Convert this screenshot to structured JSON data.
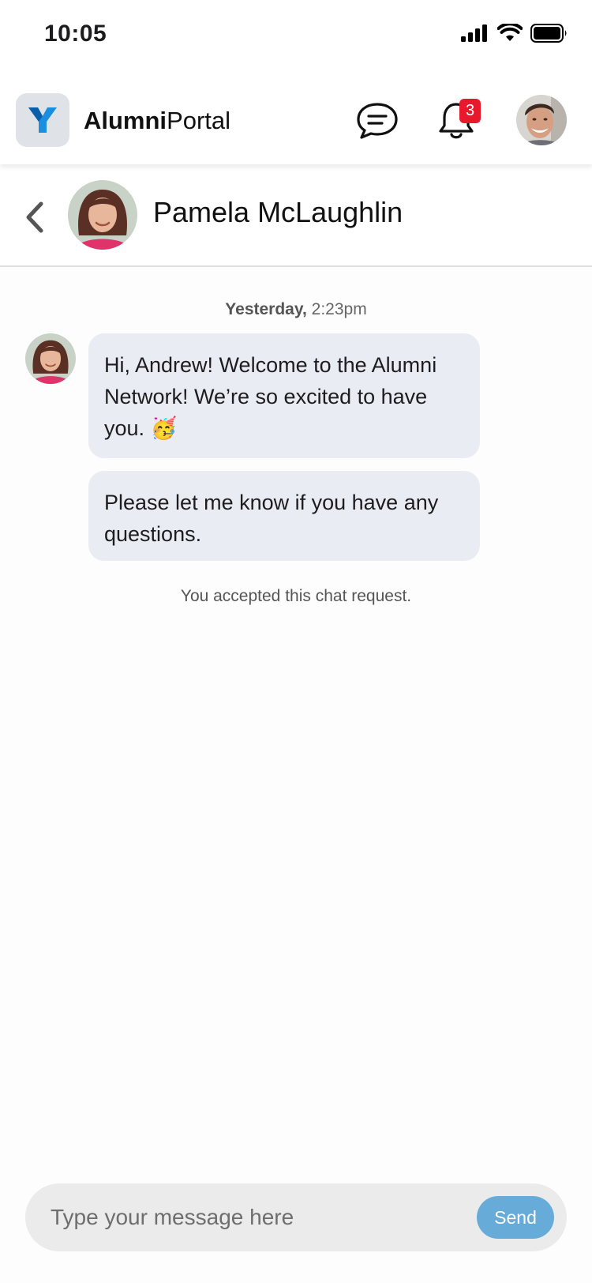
{
  "status_bar": {
    "time": "10:05",
    "icons": [
      "signal-icon",
      "wifi-icon",
      "battery-icon"
    ]
  },
  "header": {
    "app_name_bold": "Alumni",
    "app_name_regular": "Portal",
    "logo_letter": "Y",
    "notification_count": "3",
    "colors": {
      "logo_blue": "#1a8fe0",
      "badge_red": "#e8192c"
    }
  },
  "conversation": {
    "contact_name": "Pamela McLaughlin",
    "timestamp_day": "Yesterday,",
    "timestamp_time": "2:23pm",
    "messages": [
      {
        "text": "Hi, Andrew! Welcome to the Alumni Network! We’re so excited to have you. 🥳"
      },
      {
        "text": "Please let me know if you have any questions."
      }
    ],
    "system_note": "You accepted this chat request.",
    "bubble_color": "#e9ecf2"
  },
  "composer": {
    "placeholder": "Type your message here",
    "value": "",
    "send_label": "Send",
    "send_color": "#67acd9"
  }
}
